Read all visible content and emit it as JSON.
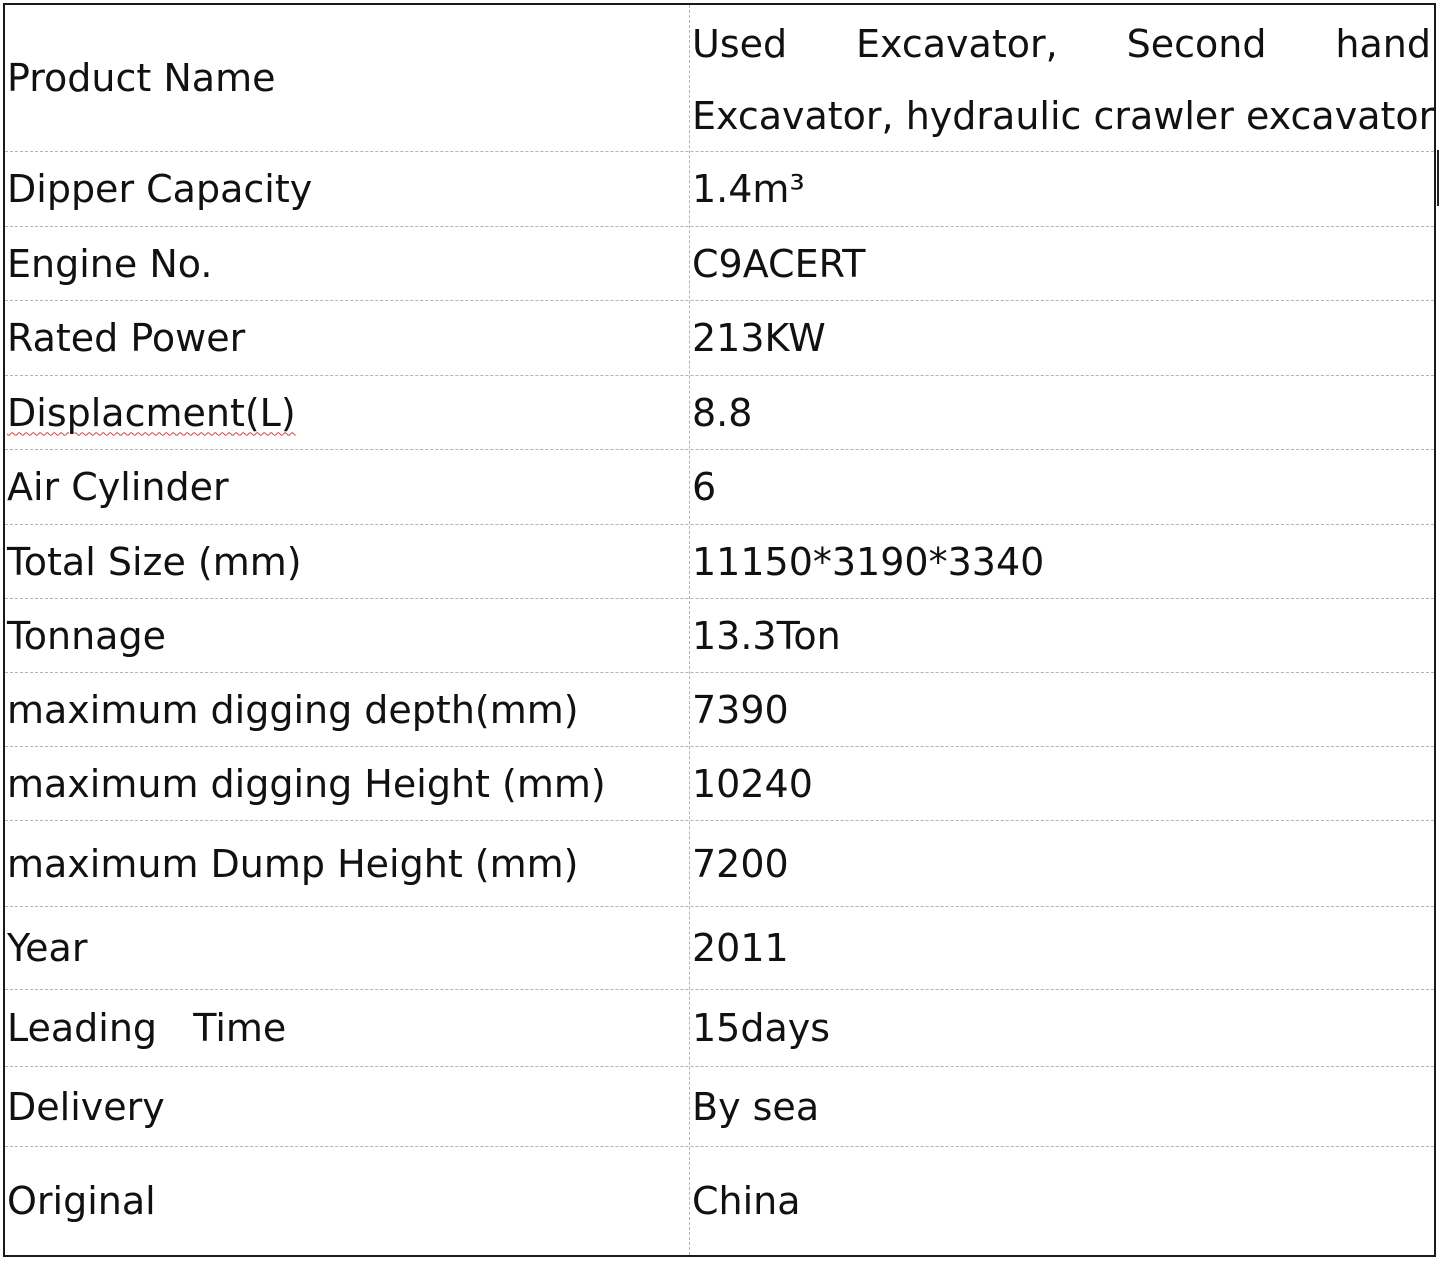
{
  "spec_table": {
    "product_name": {
      "label": "Product Name",
      "value_line1_words": [
        "Used",
        "Excavator,",
        "Second",
        "hand"
      ],
      "value_line2": "Excavator, hydraulic crawler excavator"
    },
    "rows": [
      {
        "label": "Dipper Capacity",
        "value": "1.4m³"
      },
      {
        "label": "Engine No.",
        "value": "C9ACERT"
      },
      {
        "label": "Rated Power",
        "value": "213KW"
      },
      {
        "label": "Displacment(L)",
        "value": "8.8"
      },
      {
        "label": "Air Cylinder",
        "value": "6"
      },
      {
        "label": "Total Size (mm)",
        "value": "11150*3190*3340"
      },
      {
        "label": "Tonnage",
        "value": "13.3Ton"
      },
      {
        "label": "maximum digging depth(mm)",
        "value": "7390"
      },
      {
        "label": "maximum digging Height (mm)",
        "value": "10240"
      },
      {
        "label": "maximum Dump Height (mm)",
        "value": "7200"
      },
      {
        "label": "Year",
        "value": "2011"
      },
      {
        "label": "Leading   Time",
        "value": "15days"
      },
      {
        "label": "Delivery",
        "value": "By sea"
      },
      {
        "label": "Original",
        "value": "China"
      }
    ]
  }
}
